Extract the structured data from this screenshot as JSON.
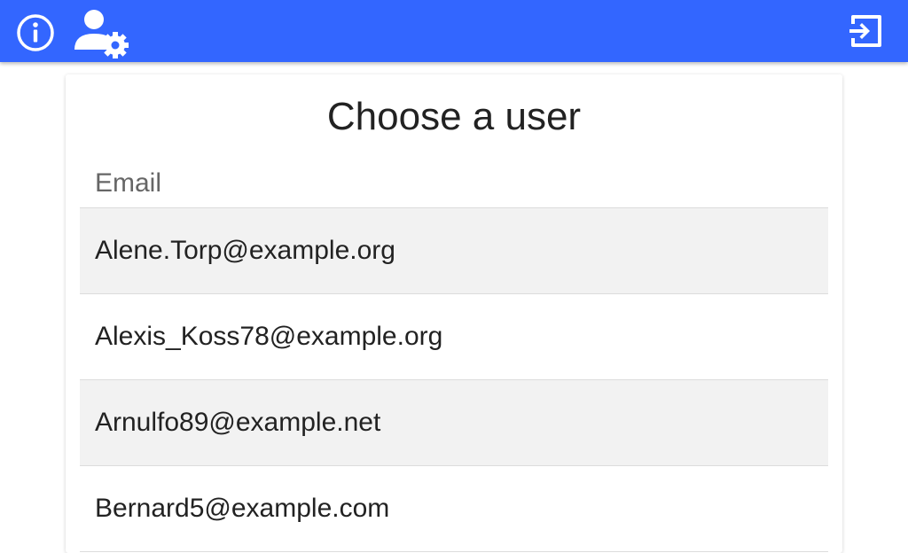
{
  "appbar": {
    "color": "#3366ff",
    "left_icons": [
      "info-icon",
      "user-settings-icon"
    ],
    "right_icons": [
      "logout-icon"
    ]
  },
  "card": {
    "title": "Choose a user",
    "column_header": "Email"
  },
  "users": [
    {
      "email": "Alene.Torp@example.org"
    },
    {
      "email": "Alexis_Koss78@example.org"
    },
    {
      "email": "Arnulfo89@example.net"
    },
    {
      "email": "Bernard5@example.com"
    }
  ]
}
